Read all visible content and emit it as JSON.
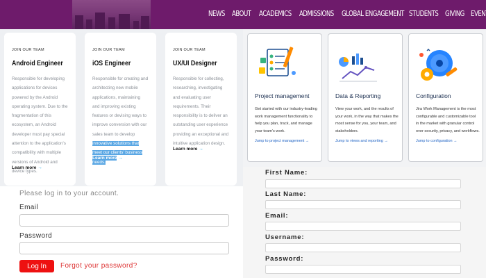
{
  "nav": {
    "items": [
      "NEWS",
      "ABOUT",
      "ACADEMICS",
      "ADMISSIONS",
      "GLOBAL ENGAGEMENT",
      "STUDENTS",
      "GIVING",
      "EVENTS"
    ]
  },
  "careers": {
    "eyebrow": "JOIN OUR TEAM",
    "jobs": [
      {
        "title": "Android Engineer",
        "description": "Responsible for developing applications for devices powered by the Android operating system. Due to the fragmentation of this ecosystem, an Android developer must pay special attention to the application's compatibility with multiple versions of Android and device types.",
        "more": "Learn more"
      },
      {
        "title": "iOS Engineer",
        "description": "Responsible for creating and architecting new mobile applications, maintaining and improving existing features or devising ways to improve conversion with our sales team to develop",
        "description_highlight": "innovative solutions that meet our clients' business needs.",
        "more": "Learn more"
      },
      {
        "title": "UX/UI Designer",
        "description": "Responsible for collecting, researching, investigating and evaluating user requirements. Their responsibility is to deliver an outstanding user experience providing an exceptional and intuitive application design.",
        "more": "Learn more"
      }
    ]
  },
  "products": [
    {
      "title": "Project management",
      "description": "Get started with our industry-leading work management functionality to help you plan, track, and manage your team's work.",
      "link": "Jump to project management →",
      "icon": "checklist-pencil-icon"
    },
    {
      "title": "Data & Reporting",
      "description": "View your work, and the results of your work, in the way that makes the most sense for you, your team, and stakeholders.",
      "link": "Jump to views and reporting →",
      "icon": "chart-report-icon"
    },
    {
      "title": "Configuration",
      "description": "Jira Work Management is the most configurable and customizable tool in the market with granular control over security, privacy, and workflows.",
      "link": "Jump to configuration →",
      "icon": "gears-wrench-icon"
    }
  ],
  "login": {
    "prompt": "Please log in to your account.",
    "email_label": "Email",
    "password_label": "Password",
    "login_button": "Log In",
    "forgot": "Forgot your password?"
  },
  "register": {
    "first_name": "First Name:",
    "last_name": "Last Name:",
    "email": "Email:",
    "username": "Username:",
    "password": "Password:"
  },
  "colors": {
    "nav_bg": "#6e1b6b",
    "accent_blue": "#16a3e0",
    "login_button": "#ee1111",
    "link_blue": "#1f63c4"
  }
}
